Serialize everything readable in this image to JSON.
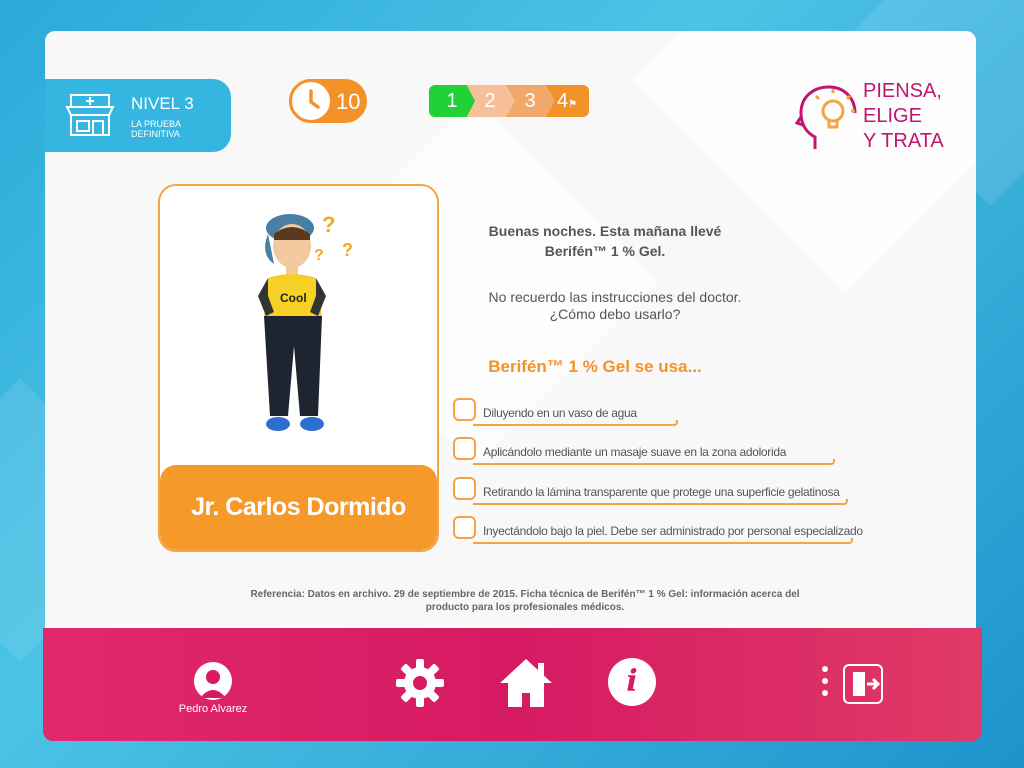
{
  "level": {
    "title": "NIVEL 3",
    "subtitle": "LA PRUEBA DEFINITIVA"
  },
  "timer": {
    "value": "10"
  },
  "steps": {
    "items": [
      "1",
      "2",
      "3",
      "4"
    ],
    "current": 1
  },
  "brand": {
    "line1": "PIENSA,",
    "line2": "ELIGE",
    "line3": "Y TRATA"
  },
  "character": {
    "name": "Jr. Carlos Dormido"
  },
  "dialogue": {
    "greeting_line1": "Buenas noches. Esta mañana llevé",
    "greeting_line2": "Berifén™ 1 % Gel.",
    "question_line1": "No recuerdo las instrucciones del doctor.",
    "question_line2": "¿Cómo debo usarlo?",
    "prompt": "Berifén™ 1 % Gel se usa..."
  },
  "options": [
    "Diluyendo en un vaso de agua",
    "Aplicándolo mediante un masaje suave en la zona adolorida",
    "Retirando la lámina transparente que protege una superficie gelatinosa",
    "Inyectándolo bajo la piel. Debe ser administrado por personal especializado"
  ],
  "reference": {
    "line1": "Referencia: Datos en archivo. 29 de septiembre de 2015. Ficha técnica de Berifén™ 1 % Gel: información acerca del",
    "line2": "producto para los profesionales médicos."
  },
  "user": {
    "name": "Pedro Alvarez"
  },
  "icons": {
    "level": "pharmacy-store-icon",
    "timer": "clock-icon",
    "brand": "head-lightbulb-icon",
    "settings": "gear-icon",
    "home": "home-icon",
    "info": "info-icon",
    "menu": "more-vertical-icon",
    "exit": "exit-door-icon"
  },
  "colors": {
    "accent_orange": "#f4922a",
    "accent_blue": "#35b6e0",
    "brand_magenta": "#c0166f",
    "bar_pink": "#d61a63",
    "step_active": "#22d136"
  }
}
